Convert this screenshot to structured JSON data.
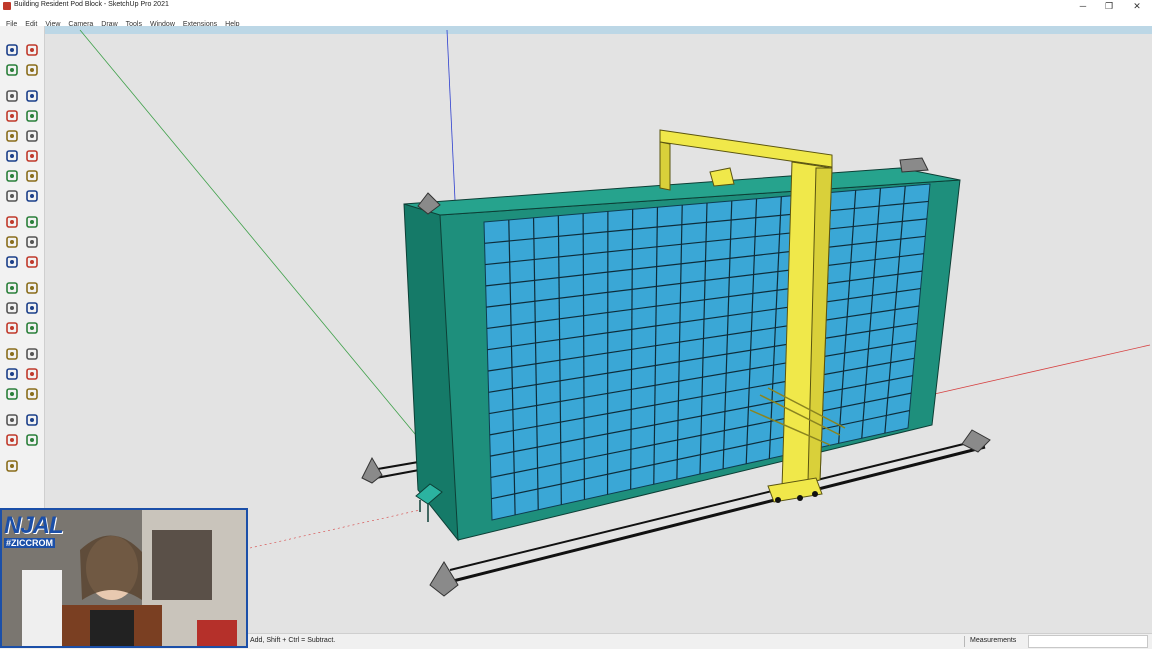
{
  "window": {
    "title": "Building Resident Pod Block - SketchUp Pro 2021",
    "minimize": "─",
    "maximize": "❐",
    "close": "✕"
  },
  "menu": [
    "File",
    "Edit",
    "View",
    "Camera",
    "Draw",
    "Tools",
    "Window",
    "Extensions",
    "Help"
  ],
  "toolbar_icons": [
    "select-icon",
    "component-icon",
    "eraser-icon",
    "line-icon",
    "freehand-icon",
    "rectangle-icon",
    "rotated-rectangle-icon",
    "circle-icon",
    "polygon-icon",
    "arc-icon",
    "pie-icon",
    "two-point-arc-icon",
    "three-point-arc-icon",
    "move-icon",
    "push-pull-icon",
    "rotate-icon",
    "follow-me-icon",
    "scale-icon",
    "offset-icon",
    "tape-measure-icon",
    "dimension-icon",
    "protractor-icon",
    "text-icon",
    "axes-icon",
    "3d-text-icon",
    "orbit-icon",
    "pan-icon",
    "zoom-icon",
    "zoom-window-icon",
    "zoom-extents-icon",
    "previous-view-icon",
    "position-camera-icon",
    "look-around-icon",
    "walk-icon",
    "section-plane-icon",
    "sandbox-icon",
    "stamp-icon",
    "drape-icon",
    "add-detail-icon"
  ],
  "status": {
    "hint": "Add, Shift + Ctrl = Subtract.",
    "measurements_label": "Measurements",
    "measurements_value": ""
  },
  "webcam": {
    "logo": "NJAL",
    "logo_sub": "#ZICCROM"
  },
  "colors": {
    "building": "#1e8f7c",
    "pods": "#3aa7d6",
    "gantry": "#f0e84a",
    "rails": "#111111",
    "axis_red": "#d64040",
    "axis_green": "#3fa04a",
    "axis_blue": "#2e3fcf"
  }
}
